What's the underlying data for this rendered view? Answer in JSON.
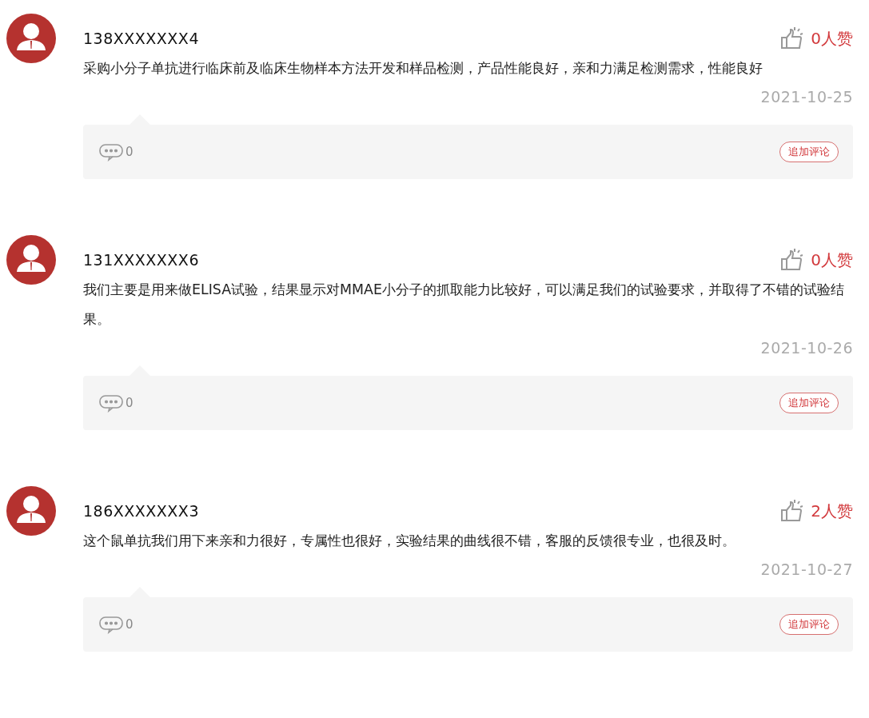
{
  "reviews": [
    {
      "user": "138XXXXXXX4",
      "likes": "0人赞",
      "text": "采购小分子单抗进行临床前及临床生物样本方法开发和样品检测，产品性能良好，亲和力满足检测需求，性能良好",
      "date": "2021-10-25",
      "comments": "0",
      "action": "追加评论"
    },
    {
      "user": "131XXXXXXX6",
      "likes": "0人赞",
      "text": "我们主要是用来做ELISA试验，结果显示对MMAE小分子的抓取能力比较好，可以满足我们的试验要求，并取得了不错的试验结果。",
      "date": "2021-10-26",
      "comments": "0",
      "action": "追加评论"
    },
    {
      "user": "186XXXXXXX3",
      "likes": "2人赞",
      "text": "这个鼠单抗我们用下来亲和力很好，专属性也很好，实验结果的曲线很不错，客服的反馈很专业，也很及时。",
      "date": "2021-10-27",
      "comments": "0",
      "action": "追加评论"
    }
  ]
}
